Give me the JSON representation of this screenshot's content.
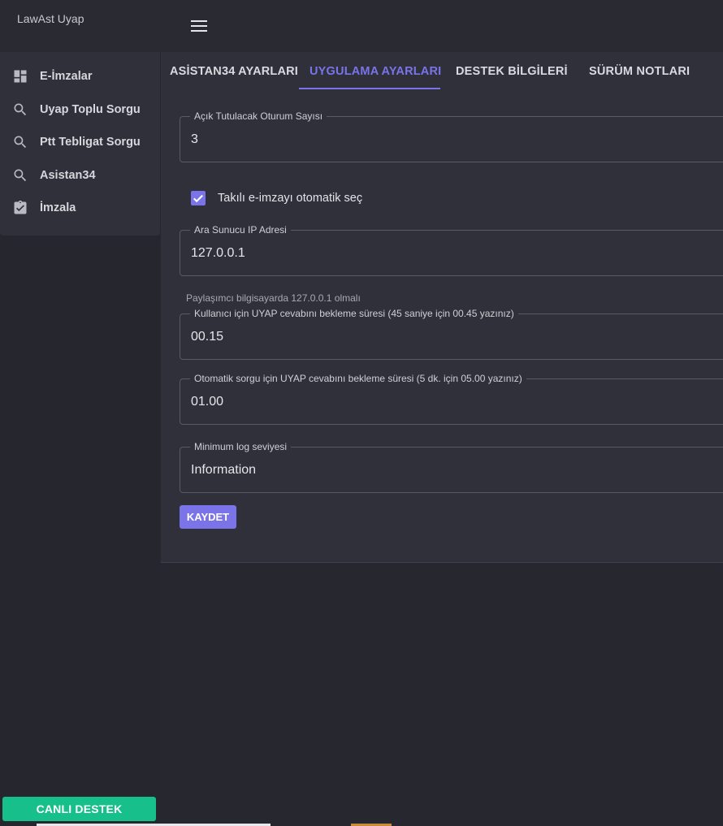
{
  "app": {
    "title": "LawAst Uyap"
  },
  "sidebar": {
    "items": [
      {
        "label": "E-İmzalar",
        "icon": "dashboard-icon"
      },
      {
        "label": "Uyap Toplu Sorgu",
        "icon": "search-icon"
      },
      {
        "label": "Ptt Tebligat Sorgu",
        "icon": "search-icon"
      },
      {
        "label": "Asistan34",
        "icon": "search-icon"
      },
      {
        "label": "İmzala",
        "icon": "clipboard-check-icon"
      }
    ],
    "live_support_label": "CANLI DESTEK"
  },
  "tabs": [
    {
      "label": "ASİSTAN34 AYARLARI",
      "active": false
    },
    {
      "label": "UYGULAMA AYARLARI",
      "active": true
    },
    {
      "label": "DESTEK BİLGİLERİ",
      "active": false
    },
    {
      "label": "SÜRÜM NOTLARI",
      "active": false
    }
  ],
  "form": {
    "session_count": {
      "label": "Açık Tutulacak Oturum Sayısı",
      "value": "3"
    },
    "auto_select": {
      "label": "Takılı e-imzayı otomatik seç",
      "checked": true
    },
    "proxy_ip": {
      "label": "Ara Sunucu IP Adresi",
      "value": "127.0.0.1",
      "helper": "Paylaşımcı bilgisayarda 127.0.0.1 olmalı"
    },
    "user_wait": {
      "label": "Kullanıcı için UYAP cevabını bekleme süresi (45 saniye için 00.45 yazınız)",
      "value": "00.15"
    },
    "auto_wait": {
      "label": "Otomatik sorgu için UYAP cevabını bekleme süresi (5 dk. için 05.00 yazınız)",
      "value": "01.00"
    },
    "log_level": {
      "label": "Minimum log seviyesi",
      "value": "Information"
    },
    "save_label": "KAYDET"
  },
  "colors": {
    "accent": "#7b74e8",
    "support": "#17c08a",
    "background": "#272730",
    "panel": "#30303a"
  }
}
